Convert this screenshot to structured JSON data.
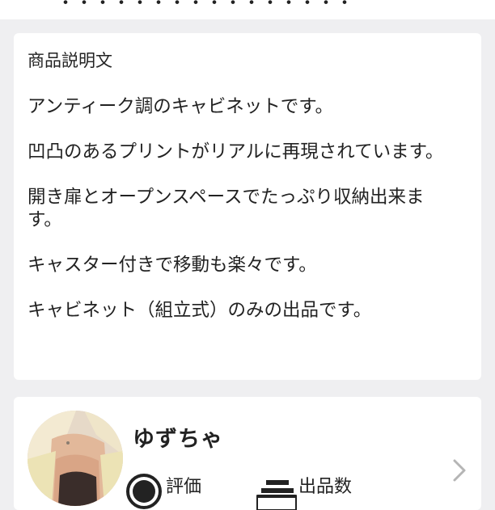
{
  "top_card": {
    "partial_text": "・・・・・・・・・・・・・・・・"
  },
  "description": {
    "heading": "商品説明文",
    "paragraphs": [
      "アンティーク調のキャビネットです。",
      "凹凸のあるプリントがリアルに再現されています。",
      "開き扉とオープンスペースでたっぷり収納出来ます。",
      "キャスター付きで移動も楽々です。",
      "キャビネット（組立式）のみの出品です。"
    ]
  },
  "seller": {
    "name": "ゆずちゃ",
    "rating_label": "評価",
    "listings_label": "出品数",
    "rating_icon": "rating-circle-icon",
    "listings_icon": "listings-box-icon",
    "chevron_icon": "chevron-right-icon"
  },
  "colors": {
    "background": "#efeff1",
    "card": "#ffffff",
    "text": "#222222",
    "chevron": "#b5b5b5"
  }
}
